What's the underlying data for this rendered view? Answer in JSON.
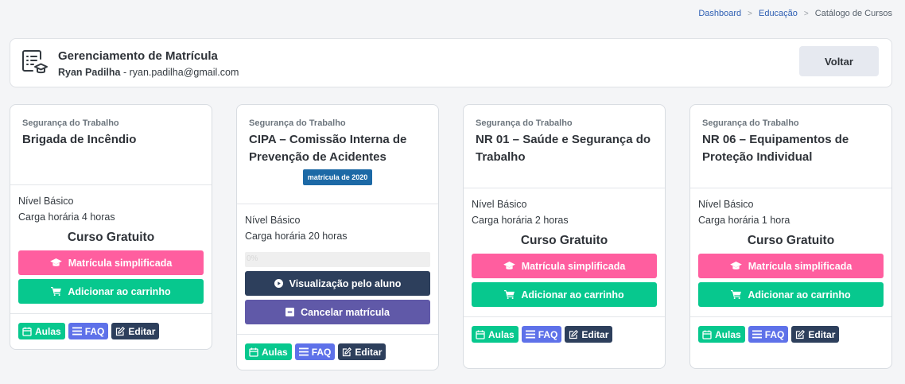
{
  "breadcrumb": {
    "items": [
      "Dashboard",
      "Educação"
    ],
    "current": "Catálogo de Cursos",
    "separator": ">"
  },
  "header": {
    "title": "Gerenciamento de Matrícula",
    "user_name": "Ryan Padilha",
    "user_email": " - ryan.padilha@gmail.com",
    "back_label": "Voltar"
  },
  "cards": [
    {
      "category": "Segurança do Trabalho",
      "title": "Brigada de Incêndio",
      "level": "Nível Básico",
      "hours": "Carga horária 4 horas",
      "price_label": "Curso Gratuito",
      "enroll_label": "Matrícula simplificada",
      "cart_label": "Adicionar ao carrinho",
      "aulas": "Aulas",
      "faq": "FAQ",
      "edit": "Editar"
    },
    {
      "category": "Segurança do Trabalho",
      "title": "CIPA – Comissão Interna de Prevenção de Acidentes",
      "badge": "matrícula de 2020",
      "level": "Nível Básico",
      "hours": "Carga horária 20 horas",
      "progress_label": "0%",
      "progress_value": 0,
      "view_label": "Visualização pelo aluno",
      "cancel_label": "Cancelar matrícula",
      "aulas": "Aulas",
      "faq": "FAQ",
      "edit": "Editar"
    },
    {
      "category": "Segurança do Trabalho",
      "title": "NR 01 – Saúde e Segurança do Trabalho",
      "level": "Nível Básico",
      "hours": "Carga horária 2 horas",
      "price_label": "Curso Gratuito",
      "enroll_label": "Matrícula simplificada",
      "cart_label": "Adicionar ao carrinho",
      "aulas": "Aulas",
      "faq": "FAQ",
      "edit": "Editar"
    },
    {
      "category": "Segurança do Trabalho",
      "title": "NR 06 – Equipamentos de Proteção Individual",
      "level": "Nível Básico",
      "hours": "Carga horária 1 hora",
      "price_label": "Curso Gratuito",
      "enroll_label": "Matrícula simplificada",
      "cart_label": "Adicionar ao carrinho",
      "aulas": "Aulas",
      "faq": "FAQ",
      "edit": "Editar"
    }
  ],
  "icons": {
    "header": "enrollment-form-icon",
    "enroll": "graduation-cap-icon",
    "cart": "shopping-cart-icon",
    "view": "play-circle-icon",
    "cancel": "minus-square-icon",
    "aulas": "calendar-icon",
    "faq": "list-icon",
    "edit": "edit-icon"
  },
  "colors": {
    "pink": "#ff5e9f",
    "green": "#07c88e",
    "navy": "#2d3f5c",
    "purple": "#6059a8",
    "blue_faq": "#5e71e9",
    "badge": "#1c69a6",
    "link": "#2e5fb3"
  }
}
